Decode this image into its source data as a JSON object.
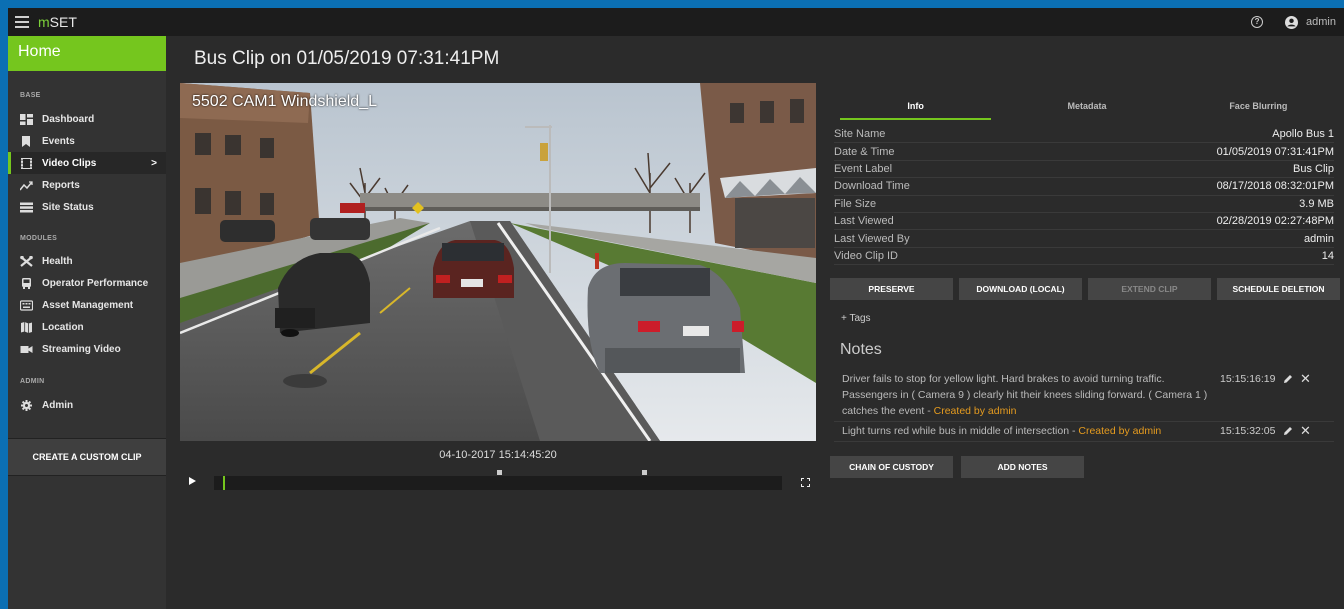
{
  "app": {
    "brand_m": "m",
    "brand_rest": "SET",
    "user": "admin"
  },
  "sidebar": {
    "home": "Home",
    "sections": {
      "base": "BASE",
      "modules": "MODULES",
      "admin": "ADMIN"
    },
    "items": [
      {
        "label": "Dashboard",
        "icon": "dashboard-icon"
      },
      {
        "label": "Events",
        "icon": "bookmark-icon"
      },
      {
        "label": "Video Clips",
        "icon": "film-icon",
        "active": true
      },
      {
        "label": "Reports",
        "icon": "trend-icon"
      },
      {
        "label": "Site Status",
        "icon": "list-icon"
      },
      {
        "label": "Health",
        "icon": "tools-icon"
      },
      {
        "label": "Operator Performance",
        "icon": "bus-icon"
      },
      {
        "label": "Asset Management",
        "icon": "keyboard-icon"
      },
      {
        "label": "Location",
        "icon": "map-icon"
      },
      {
        "label": "Streaming Video",
        "icon": "videocam-icon"
      },
      {
        "label": "Admin",
        "icon": "gear-icon"
      }
    ],
    "chevron": ">",
    "custom_clip": "CREATE A CUSTOM CLIP"
  },
  "page": {
    "title": "Bus Clip on 01/05/2019 07:31:41PM"
  },
  "video": {
    "camera_label": "5502 CAM1 Windshield_L",
    "timestamp": "04-10-2017 15:14:45:20"
  },
  "tabs": [
    "Info",
    "Metadata",
    "Face Blurring"
  ],
  "info": [
    {
      "key": "Site Name",
      "value": "Apollo Bus 1"
    },
    {
      "key": "Date & Time",
      "value": "01/05/2019 07:31:41PM"
    },
    {
      "key": "Event Label",
      "value": "Bus Clip"
    },
    {
      "key": "Download Time",
      "value": "08/17/2018 08:32:01PM"
    },
    {
      "key": "File Size",
      "value": "3.9 MB"
    },
    {
      "key": "Last Viewed",
      "value": "02/28/2019 02:27:48PM"
    },
    {
      "key": "Last Viewed By",
      "value": "admin"
    },
    {
      "key": "Video Clip ID",
      "value": "14"
    }
  ],
  "actions": {
    "preserve": "PRESERVE",
    "download": "DOWNLOAD (LOCAL)",
    "extend": "EXTEND CLIP",
    "schedule": "SCHEDULE DELETION"
  },
  "tags_label": "+ Tags",
  "notes": {
    "title": "Notes",
    "items": [
      {
        "text": "Driver fails to stop for yellow light. Hard brakes to avoid turning traffic. Passengers in ( Camera 9 ) clearly hit their knees sliding forward. ( Camera 1 ) catches the event - ",
        "by": "Created by admin",
        "time": "15:15:16:19"
      },
      {
        "text": "Light turns red while bus in middle of intersection - ",
        "by": "Created by admin",
        "time": "15:15:32:05"
      }
    ],
    "close_glyph": "✕"
  },
  "bottom_actions": {
    "chain": "CHAIN OF CUSTODY",
    "add_notes": "ADD NOTES"
  },
  "colors": {
    "accent": "#75c61e",
    "note_author": "#e59b1f",
    "frame": "#0b6fb3"
  }
}
